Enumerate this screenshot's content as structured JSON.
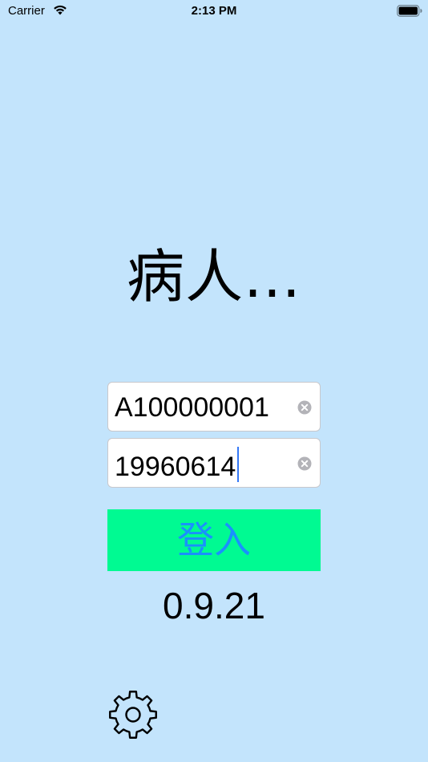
{
  "status_bar": {
    "carrier": "Carrier",
    "time": "2:13 PM",
    "icons": [
      "wifi-icon",
      "battery-icon"
    ]
  },
  "title": "病人...",
  "login_form": {
    "id_field": {
      "value": "A100000001"
    },
    "password_field": {
      "value": "19960614"
    },
    "login_button_label": "登入"
  },
  "version": "0.9.21",
  "settings": {
    "icon": "gear-icon"
  },
  "colors": {
    "background": "#c3e4fc",
    "login_button_bg": "#00fa92",
    "login_button_text": "#1a90ff",
    "caret": "#3478f6"
  }
}
